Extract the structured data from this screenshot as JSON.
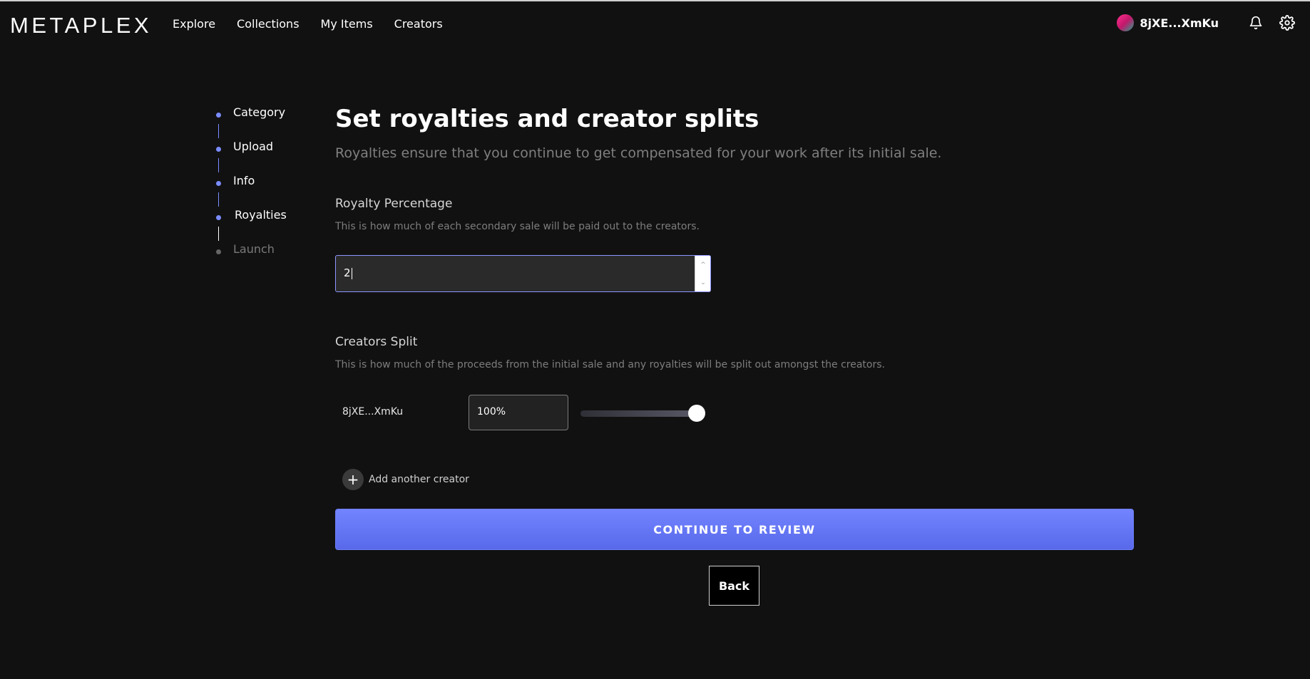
{
  "brand": {
    "logo": "METAPLEX"
  },
  "nav": [
    {
      "label": "Explore"
    },
    {
      "label": "Collections"
    },
    {
      "label": "My Items"
    },
    {
      "label": "Creators"
    }
  ],
  "account": {
    "wallet": "8jXE...XmKu"
  },
  "icons": {
    "notifications": "bell-icon",
    "settings": "gear-icon",
    "add": "plus-icon"
  },
  "steps": [
    {
      "label": "Category",
      "state": "done"
    },
    {
      "label": "Upload",
      "state": "done"
    },
    {
      "label": "Info",
      "state": "done"
    },
    {
      "label": "Royalties",
      "state": "current"
    },
    {
      "label": "Launch",
      "state": "upcoming"
    }
  ],
  "page": {
    "title": "Set royalties and creator splits",
    "subtitle": "Royalties ensure that you continue to get compensated for your work after its initial sale."
  },
  "royalty": {
    "title": "Royalty Percentage",
    "description": "This is how much of each secondary sale will be paid out to the creators.",
    "value": "2"
  },
  "creators": {
    "title": "Creators Split",
    "description": "This is how much of the proceeds from the initial sale and any royalties will be split out amongst the creators.",
    "rows": [
      {
        "name": "8jXE...XmKu",
        "share": "100%",
        "slider_fraction": 1.0
      }
    ],
    "add_label": "Add another creator"
  },
  "actions": {
    "continue": "CONTINUE TO REVIEW",
    "back": "Back"
  },
  "colors": {
    "accent": "#6f80ff",
    "background": "#111111",
    "muted": "#7f7f7f"
  }
}
